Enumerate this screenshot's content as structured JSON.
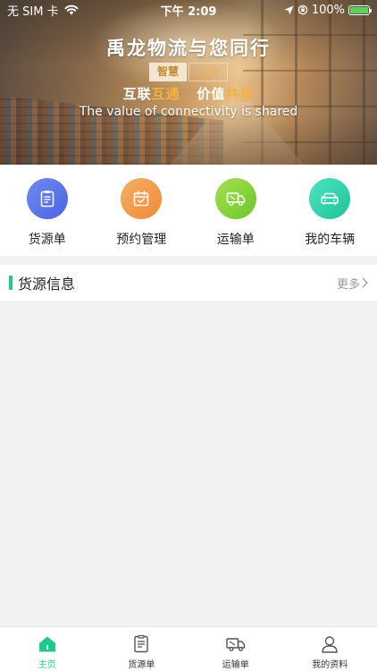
{
  "status_bar": {
    "carrier": "无 SIM 卡",
    "time": "下午 2:09",
    "battery": "100%"
  },
  "banner": {
    "title": "禹龙物流与您同行",
    "tag_a": "智慧",
    "tag_b": "运营",
    "slogan_1": "互联",
    "slogan_1_hl": "互通",
    "slogan_2": "价值",
    "slogan_2_hl": "共享",
    "slogan_en": "The value of connectivity is shared"
  },
  "quick_menu": [
    {
      "label": "货源单",
      "icon": "clipboard-icon",
      "color_from": "#6f8cf2",
      "color_to": "#4a62e0"
    },
    {
      "label": "预约管理",
      "icon": "calendar-check-icon",
      "color_from": "#f6b068",
      "color_to": "#ee8a34"
    },
    {
      "label": "运输单",
      "icon": "truck-icon",
      "color_from": "#a8df52",
      "color_to": "#6bc62b"
    },
    {
      "label": "我的车辆",
      "icon": "car-icon",
      "color_from": "#4ee3c2",
      "color_to": "#20c39a"
    }
  ],
  "section": {
    "title": "货源信息",
    "more": "更多"
  },
  "tab_bar": [
    {
      "label": "主页",
      "icon": "home-icon",
      "active": true
    },
    {
      "label": "货源单",
      "icon": "document-icon",
      "active": false
    },
    {
      "label": "运输单",
      "icon": "truck-icon",
      "active": false
    },
    {
      "label": "我的资料",
      "icon": "user-icon",
      "active": false
    }
  ],
  "colors": {
    "accent": "#1ec98a",
    "banner_highlight": "#f2b340"
  }
}
